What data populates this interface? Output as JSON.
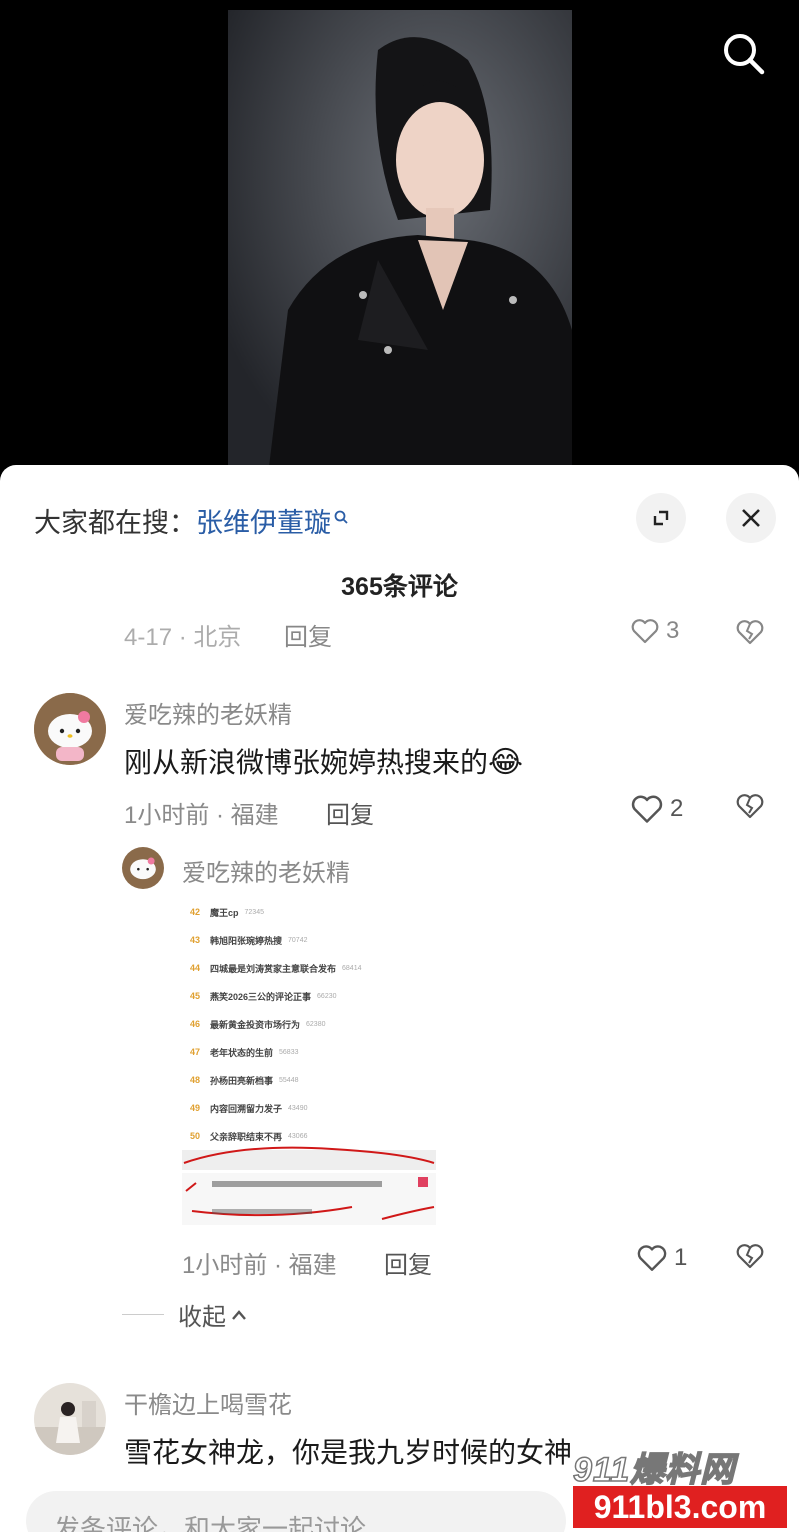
{
  "hot_search": {
    "label": "大家都在搜：",
    "keyword": "张维伊董璇"
  },
  "comment_count": "365条评论",
  "prev_comment": {
    "meta": "4-17 · 北京",
    "reply": "回复",
    "likes": "3"
  },
  "comments": [
    {
      "username": "爱吃辣的老妖精",
      "text": "刚从新浪微博张婉婷热搜来的",
      "emoji": "😂",
      "meta": "1小时前 · 福建",
      "reply": "回复",
      "likes": "2",
      "sub_reply": {
        "username": "爱吃辣的老妖精",
        "meta": "1小时前 · 福建",
        "reply": "回复",
        "likes": "1",
        "screenshot_rows": [
          {
            "num": "42",
            "title": "魔王cp",
            "value": "72345"
          },
          {
            "num": "43",
            "title": "韩旭阳张琬婷热搜",
            "value": "70742"
          },
          {
            "num": "44",
            "title": "四城最是刘涛赏家主意联合发布",
            "value": "68414"
          },
          {
            "num": "45",
            "title": "燕笑2026三公的评论正事",
            "value": "66230"
          },
          {
            "num": "46",
            "title": "最新黄金投资市场行为",
            "value": "62380"
          },
          {
            "num": "47",
            "title": "老年状态的生前",
            "value": "56833"
          },
          {
            "num": "48",
            "title": "孙杨田亮新档事",
            "value": "55448"
          },
          {
            "num": "49",
            "title": "内容回溯留力发子",
            "value": "43490"
          },
          {
            "num": "50",
            "title": "父亲辞职结束不再",
            "value": "43066"
          }
        ]
      }
    },
    {
      "username": "干檐边上喝雪花",
      "text": "雪花女神龙，你是我九岁时候的女神"
    }
  ],
  "collapse_label": "收起",
  "input_placeholder": "发条评论，和大家一起讨论",
  "watermark": {
    "top": "911爆料网",
    "bottom": "911bl3.com"
  }
}
